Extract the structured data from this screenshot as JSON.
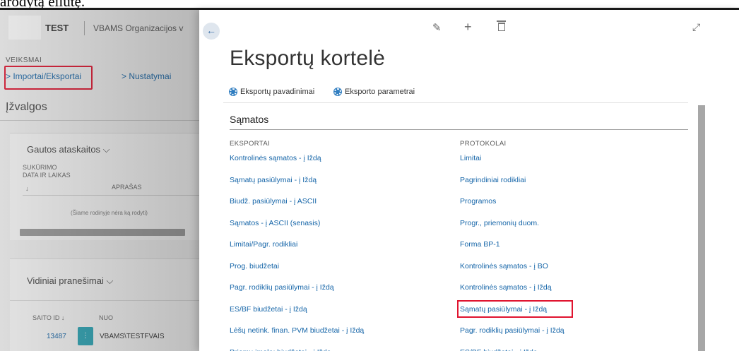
{
  "caption": "arodytą eilutę.",
  "background_page": {
    "company": "TEST",
    "organization": "VBAMS Organizacijos v",
    "actions_header": "VEIKSMAI",
    "actions": [
      {
        "label": "> Importai/Eksportai",
        "highlighted": true
      },
      {
        "label": "> Nustatymai",
        "highlighted": false
      }
    ],
    "insights_title": "Įžvalgos",
    "received_reports": {
      "title": "Gautos ataskaitos",
      "columns": [
        "SUKŪRIMO DATA IR LAIKAS ↓",
        "APRAŠAS"
      ],
      "col_created_line1": "SUKŪRIMO",
      "col_created_line2": "DATA IR LAIKAS",
      "col_sort_arrow": "↓",
      "col_desc": "APRAŠAS",
      "empty_message": "(Šiame rodinyje nėra ką rodyti)"
    },
    "internal_messages": {
      "title": "Vidiniai pranešimai",
      "col_id": "SAITO ID ↓",
      "col_from": "NUO",
      "rows": [
        {
          "id": "13487",
          "mark": "⋮",
          "from": "VBAMS\\TESTFVAIS"
        }
      ]
    }
  },
  "panel": {
    "back_icon": "arrow-left-icon",
    "toolbar_icons": [
      "edit-icon",
      "add-icon",
      "delete-icon",
      "expand-icon"
    ],
    "title": "Eksportų kortelė",
    "nav": [
      {
        "label": "Eksportų pavadinimai",
        "icon": "gear-icon"
      },
      {
        "label": "Eksporto parametrai",
        "icon": "gear-icon"
      }
    ],
    "section_title": "Sąmatos",
    "exports_header": "EKSPORTAI",
    "protocols_header": "PROTOKOLAI",
    "exports": [
      "Kontrolinės sąmatos - į Iždą",
      "Sąmatų pasiūlymai - į Iždą",
      "Biudž. pasiūlymai - į ASCII",
      "Sąmatos - į ASCII (senasis)",
      "Limitai/Pagr. rodikliai",
      "Prog. biudžetai",
      "Pagr. rodiklių pasiūlymai - į Iždą",
      "ES/BF biudžetai - į Iždą",
      "Lėšų netink. finan. PVM biudžetai - į Iždą",
      "Priemų įmokų biudžetai - į Iždą"
    ],
    "protocols": [
      "Limitai",
      "Pagrindiniai rodikliai",
      "Programos",
      "Progr., priemonių duom.",
      "Forma BP-1",
      "Kontrolinės sąmatos - į BO",
      "Kontrolinės sąmatos - į Iždą",
      "Sąmatų pasiūlymai - į Iždą",
      "Pagr. rodiklių pasiūlymai - į Iždą",
      "ES/BF biudžetai - į Iždą"
    ],
    "highlighted_protocol": "Sąmatų pasiūlymai - į Iždą"
  },
  "colors": {
    "link": "#1565a8",
    "highlight_border": "#e0142f",
    "accent": "#2aa6b7"
  }
}
